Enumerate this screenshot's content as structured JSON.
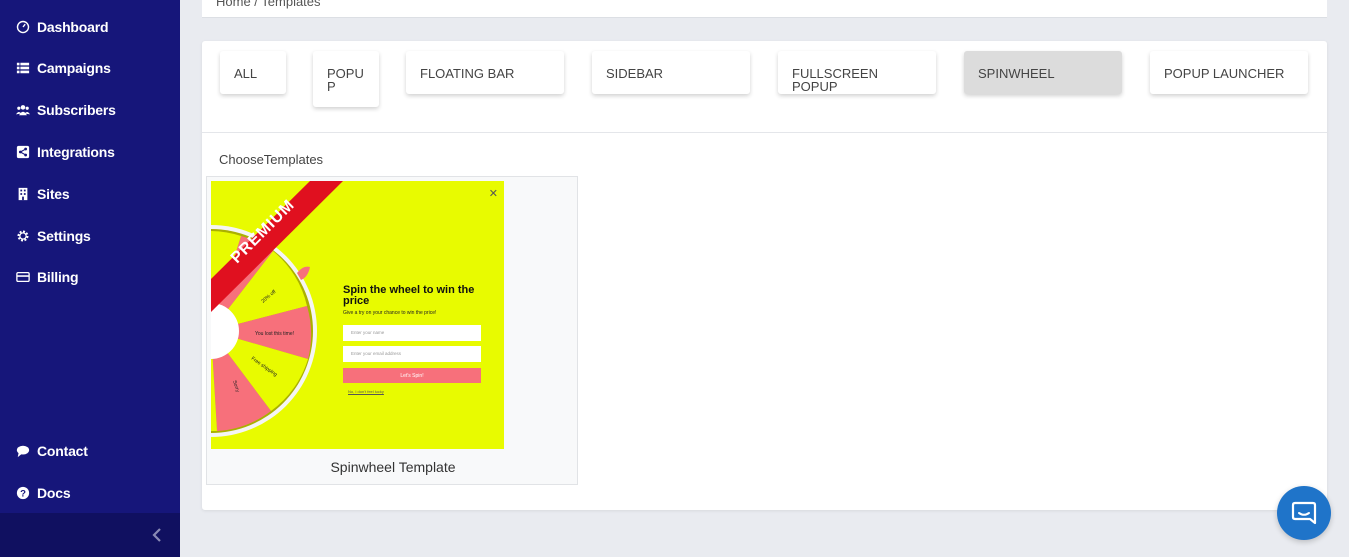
{
  "sidebar": {
    "items": [
      {
        "label": "Dashboard",
        "icon": "dashboard-icon"
      },
      {
        "label": "Campaigns",
        "icon": "list-icon"
      },
      {
        "label": "Subscribers",
        "icon": "users-icon"
      },
      {
        "label": "Integrations",
        "icon": "share-icon"
      },
      {
        "label": "Sites",
        "icon": "building-icon"
      },
      {
        "label": "Settings",
        "icon": "gear-icon"
      },
      {
        "label": "Billing",
        "icon": "credit-card-icon"
      }
    ],
    "bottom_items": [
      {
        "label": "Contact",
        "icon": "comment-icon"
      },
      {
        "label": "Docs",
        "icon": "question-icon"
      }
    ],
    "collapse_icon": "chevron-left-icon"
  },
  "breadcrumb": {
    "text": "Home / Templates"
  },
  "tabs": [
    {
      "label": "ALL",
      "active": false
    },
    {
      "label": "POPUP",
      "active": false
    },
    {
      "label": "FLOATING BAR",
      "active": false
    },
    {
      "label": "SIDEBAR",
      "active": false
    },
    {
      "label": "FULLSCREEN POPUP",
      "active": false
    },
    {
      "label": "SPINWHEEL",
      "active": true
    },
    {
      "label": "POPUP LAUNCHER",
      "active": false
    }
  ],
  "section_label": "ChooseTemplates",
  "templates": [
    {
      "name": "Spinwheel Template",
      "ribbon": "PREMIUM",
      "preview": {
        "title": "Spin the wheel to win the price",
        "subtitle": "Give a try on your chance to win the price!",
        "name_placeholder": "Enter your name",
        "email_placeholder": "Enter your email address",
        "button": "Let's Spin!",
        "decline": "No, I don't feel lucky",
        "slices": [
          "20% off",
          "You lost this time!",
          "Free shipping",
          "Sorry"
        ]
      }
    }
  ],
  "colors": {
    "sidebar_bg": "#16167a",
    "preview_bg": "#e8fb00",
    "ribbon": "#e0101f",
    "slice_pink": "#f7707b",
    "chat": "#1f74c9"
  },
  "chat_icon": "chat-icon"
}
